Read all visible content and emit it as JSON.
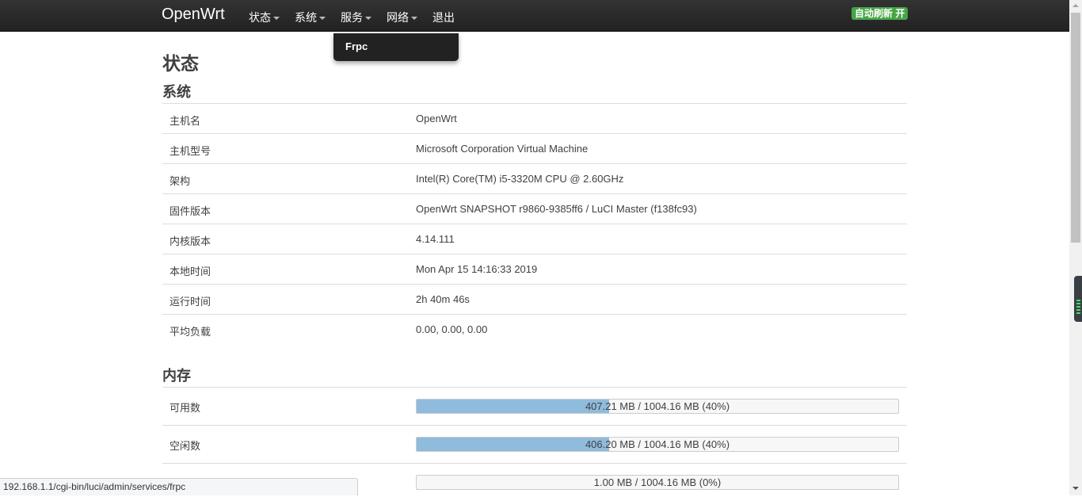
{
  "navbar": {
    "brand": "OpenWrt",
    "menus": [
      {
        "label": "状态"
      },
      {
        "label": "系统"
      },
      {
        "label": "服务"
      },
      {
        "label": "网络"
      }
    ],
    "logout": "退出",
    "auto_refresh": "自动刷新 开",
    "dropdown_item": "Frpc"
  },
  "page": {
    "title": "状态"
  },
  "system": {
    "heading": "系统",
    "rows": [
      {
        "key": "主机名",
        "value": "OpenWrt"
      },
      {
        "key": "主机型号",
        "value": "Microsoft Corporation Virtual Machine"
      },
      {
        "key": "架构",
        "value": "Intel(R) Core(TM) i5-3320M CPU @ 2.60GHz"
      },
      {
        "key": "固件版本",
        "value": "OpenWrt SNAPSHOT r9860-9385ff6 / LuCI Master (f138fc93)"
      },
      {
        "key": "内核版本",
        "value": "4.14.111"
      },
      {
        "key": "本地时间",
        "value": "Mon Apr 15 14:16:33 2019"
      },
      {
        "key": "运行时间",
        "value": "2h 40m 46s"
      },
      {
        "key": "平均负载",
        "value": "0.00, 0.00, 0.00"
      }
    ]
  },
  "memory": {
    "heading": "内存",
    "rows": [
      {
        "key": "可用数",
        "label": "407.21 MB / 1004.16 MB (40%)",
        "percent": 40
      },
      {
        "key": "空闲数",
        "label": "406.20 MB / 1004.16 MB (40%)",
        "percent": 40
      },
      {
        "key": "",
        "label": "1.00 MB / 1004.16 MB (0%)",
        "percent": 0
      }
    ]
  },
  "statusbar": {
    "url": "192.168.1.1/cgi-bin/luci/admin/services/frpc"
  },
  "colors": {
    "navbar": "#222222",
    "bar_fill": "#8fbbdd",
    "badge": "#46a546"
  }
}
